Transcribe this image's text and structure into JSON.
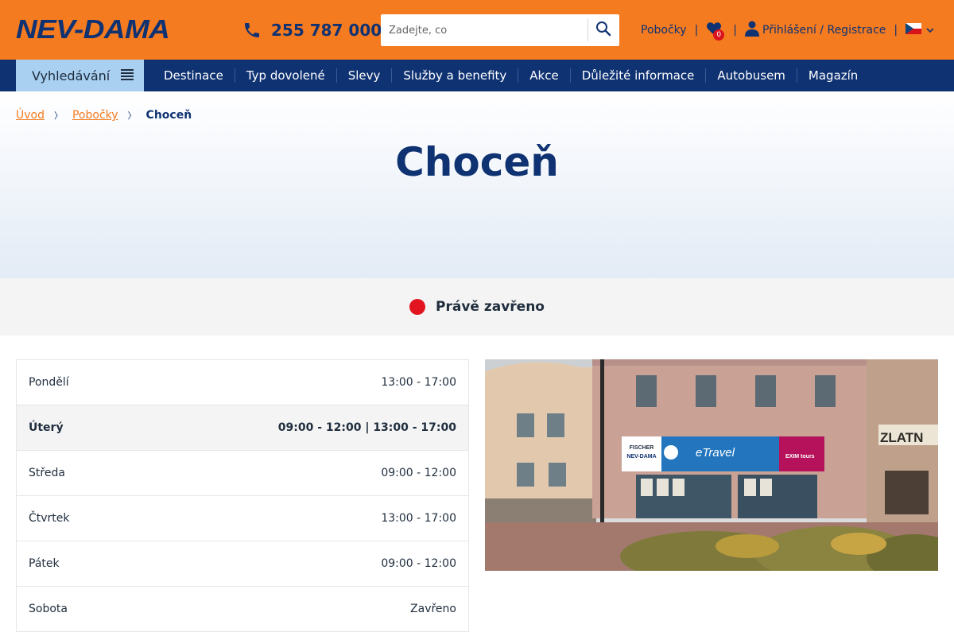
{
  "header": {
    "logo_text": "NEV-DAMA",
    "phone": "255 787 000",
    "search_placeholder": "Zadejte, co",
    "branches_link": "Pobočky",
    "favorites_count": "0",
    "login_link": "Přihlášení / Registrace",
    "language": "cs"
  },
  "nav": {
    "search_label": "Vyhledávání",
    "items": [
      {
        "label": "Destinace"
      },
      {
        "label": "Typ dovolené"
      },
      {
        "label": "Slevy"
      },
      {
        "label": "Služby a benefity"
      },
      {
        "label": "Akce"
      },
      {
        "label": "Důležité informace"
      },
      {
        "label": "Autobusem"
      },
      {
        "label": "Magazín"
      }
    ]
  },
  "breadcrumb": {
    "home": "Úvod",
    "branches": "Pobočky",
    "current": "Choceň"
  },
  "page_title": "Choceň",
  "status": {
    "text": "Právě zavřeno",
    "color": "#e2141f"
  },
  "opening_hours": [
    {
      "day": "Pondělí",
      "hours": "13:00 - 17:00"
    },
    {
      "day": "Úterý",
      "hours": "09:00 - 12:00 | 13:00 - 17:00"
    },
    {
      "day": "Středa",
      "hours": "09:00 - 12:00"
    },
    {
      "day": "Čtvrtek",
      "hours": "13:00 - 17:00"
    },
    {
      "day": "Pátek",
      "hours": "09:00 - 12:00"
    },
    {
      "day": "Sobota",
      "hours": "Zavřeno"
    }
  ],
  "photo": {
    "sign_fischer": "FISCHER",
    "sign_nevdama": "NEV-DAMA",
    "sign_etravel": "eTravel",
    "sign_exim": "EXIM tours",
    "sign_zlatn": "ZLATN"
  },
  "colors": {
    "brand_orange": "#f47b20",
    "brand_navy": "#0f3272",
    "nav_search_bg": "#a9cff1"
  }
}
